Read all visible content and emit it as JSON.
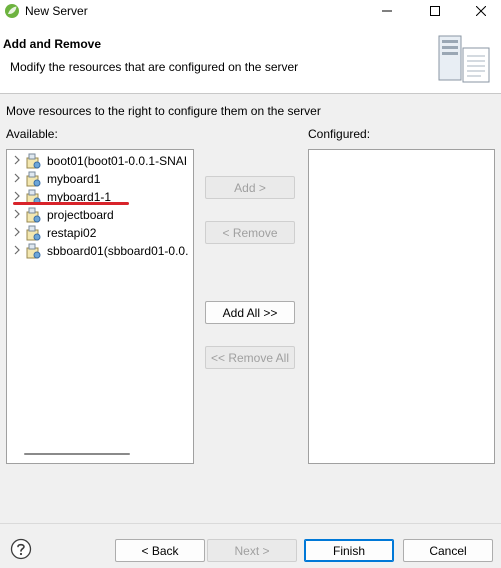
{
  "window": {
    "title": "New Server",
    "controls": [
      "minimize-icon",
      "maximize-icon",
      "close-icon"
    ]
  },
  "banner": {
    "title": "Add and Remove",
    "description": "Modify the resources that are configured on the server",
    "image_icon": "server-icon"
  },
  "instruction": "Move resources to the right to configure them on the server",
  "available": {
    "label": "Available:",
    "items": [
      {
        "label": "boot01(boot01-0.0.1-SNAI",
        "icon": "project-icon"
      },
      {
        "label": "myboard1",
        "icon": "project-icon"
      },
      {
        "label": "myboard1-1",
        "icon": "project-icon",
        "underlined": true
      },
      {
        "label": "projectboard",
        "icon": "project-icon"
      },
      {
        "label": "restapi02",
        "icon": "project-icon"
      },
      {
        "label": "sbboard01(sbboard01-0.0.",
        "icon": "project-icon"
      }
    ]
  },
  "configured": {
    "label": "Configured:",
    "items": []
  },
  "buttons": {
    "add": "Add >",
    "remove": "< Remove",
    "add_all": "Add All >>",
    "remove_all": "<< Remove All",
    "back": "< Back",
    "next": "Next >",
    "finish": "Finish",
    "cancel": "Cancel"
  },
  "colors": {
    "annotation_underline": "#d8232a",
    "default_button_border": "#0078d7"
  },
  "help_icon": "question-mark-icon"
}
